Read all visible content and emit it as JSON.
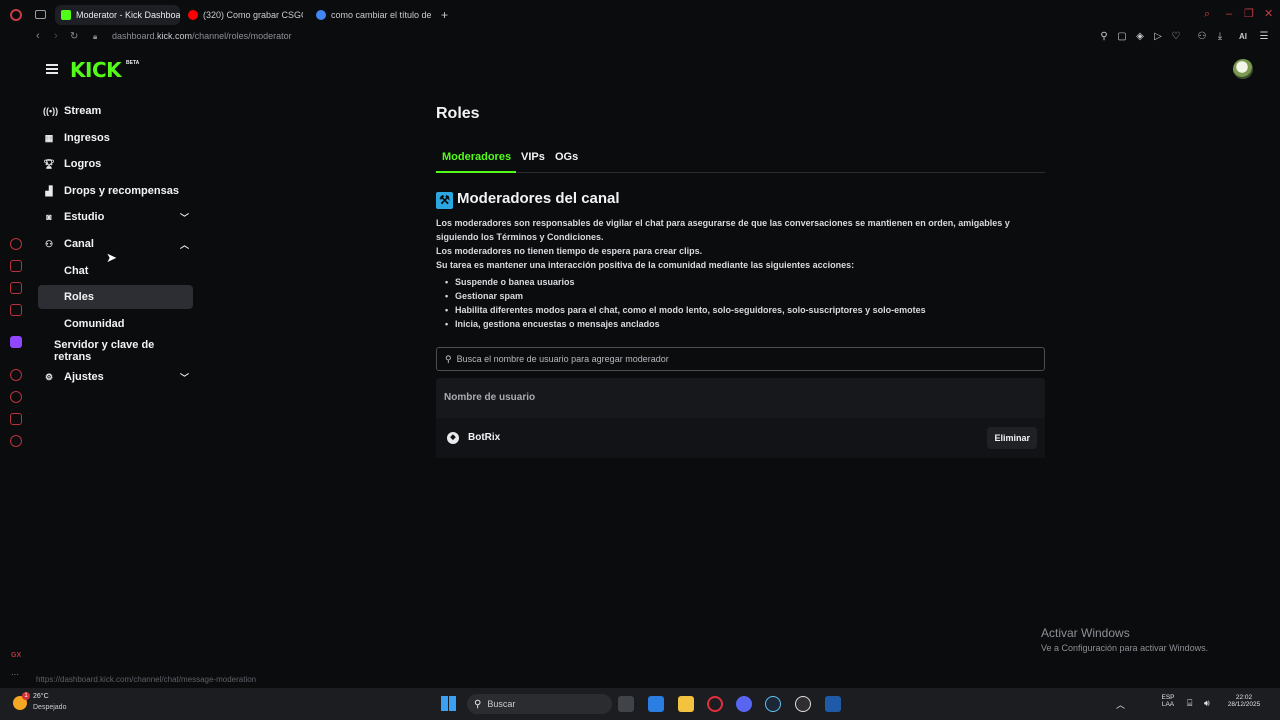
{
  "browser": {
    "tabs": [
      {
        "label": "Moderator - Kick Dashboa",
        "active": true,
        "favicon_color": "#53fc18"
      },
      {
        "label": "(320) Como grabar CSGO",
        "active": false,
        "favicon_color": "#ff0000"
      },
      {
        "label": "como cambiar el título de",
        "active": false,
        "favicon_color": "#4285f4"
      }
    ],
    "new_tab": "+",
    "url_prefix": "dashboard.",
    "url_domain": "kick.com",
    "url_path": "/channel/roles/moderator",
    "status_url": "https://dashboard.kick.com/channel/chat/message-moderation",
    "toolbar_ai": "AI"
  },
  "header": {
    "logo": "KICK",
    "logo_badge": "BETA"
  },
  "sidebar": {
    "items": [
      {
        "label": "Stream",
        "icon": "broadcast-icon"
      },
      {
        "label": "Ingresos",
        "icon": "chart-icon"
      },
      {
        "label": "Logros",
        "icon": "trophy-icon"
      },
      {
        "label": "Drops y recompensas",
        "icon": "gift-icon"
      },
      {
        "label": "Estudio",
        "icon": "camera-icon",
        "chevron": "down"
      },
      {
        "label": "Canal",
        "icon": "users-icon",
        "chevron": "up"
      }
    ],
    "channel_sub": [
      "Chat",
      "Roles",
      "Comunidad"
    ],
    "server_item": "Servidor y clave de retrans",
    "settings": {
      "label": "Ajustes",
      "icon": "gear-icon",
      "chevron": "down"
    }
  },
  "main": {
    "title": "Roles",
    "tabs": [
      "Moderadores",
      "VIPs",
      "OGs"
    ],
    "section_title": "Moderadores del canal",
    "desc_1": "Los moderadores son responsables de vigilar el chat para asegurarse de que las conversaciones se mantienen en orden, amigables y siguiendo los Términos y Condiciones.",
    "desc_2": "Los moderadores no tienen tiempo de espera para crear clips.",
    "desc_3": "Su tarea es mantener una interacción positiva de la comunidad mediante las siguientes acciones:",
    "bullets": [
      "Suspende o banea usuarios",
      "Gestionar spam",
      "Habilita diferentes modos para el chat, como el modo lento, solo-seguidores, solo-suscriptores y solo-emotes",
      "Inicia, gestiona encuestas o mensajes anclados"
    ],
    "search_placeholder": "Busca el nombre de usuario para agregar moderador",
    "table_header": "Nombre de usuario",
    "rows": [
      {
        "username": "BotRix",
        "action": "Eliminar"
      }
    ]
  },
  "watermark": {
    "line1": "Activar Windows",
    "line2": "Ve a Configuración para activar Windows."
  },
  "taskbar": {
    "weather_temp": "26°C",
    "weather_desc": "Despejado",
    "weather_badge": "1",
    "search": "Buscar",
    "lang_1": "ESP",
    "lang_2": "LAA",
    "time": "22:02",
    "date": "28/12/2025"
  },
  "colors": {
    "accent": "#53fc18",
    "background": "#0b0c0e",
    "opera_red": "#b8323d"
  }
}
